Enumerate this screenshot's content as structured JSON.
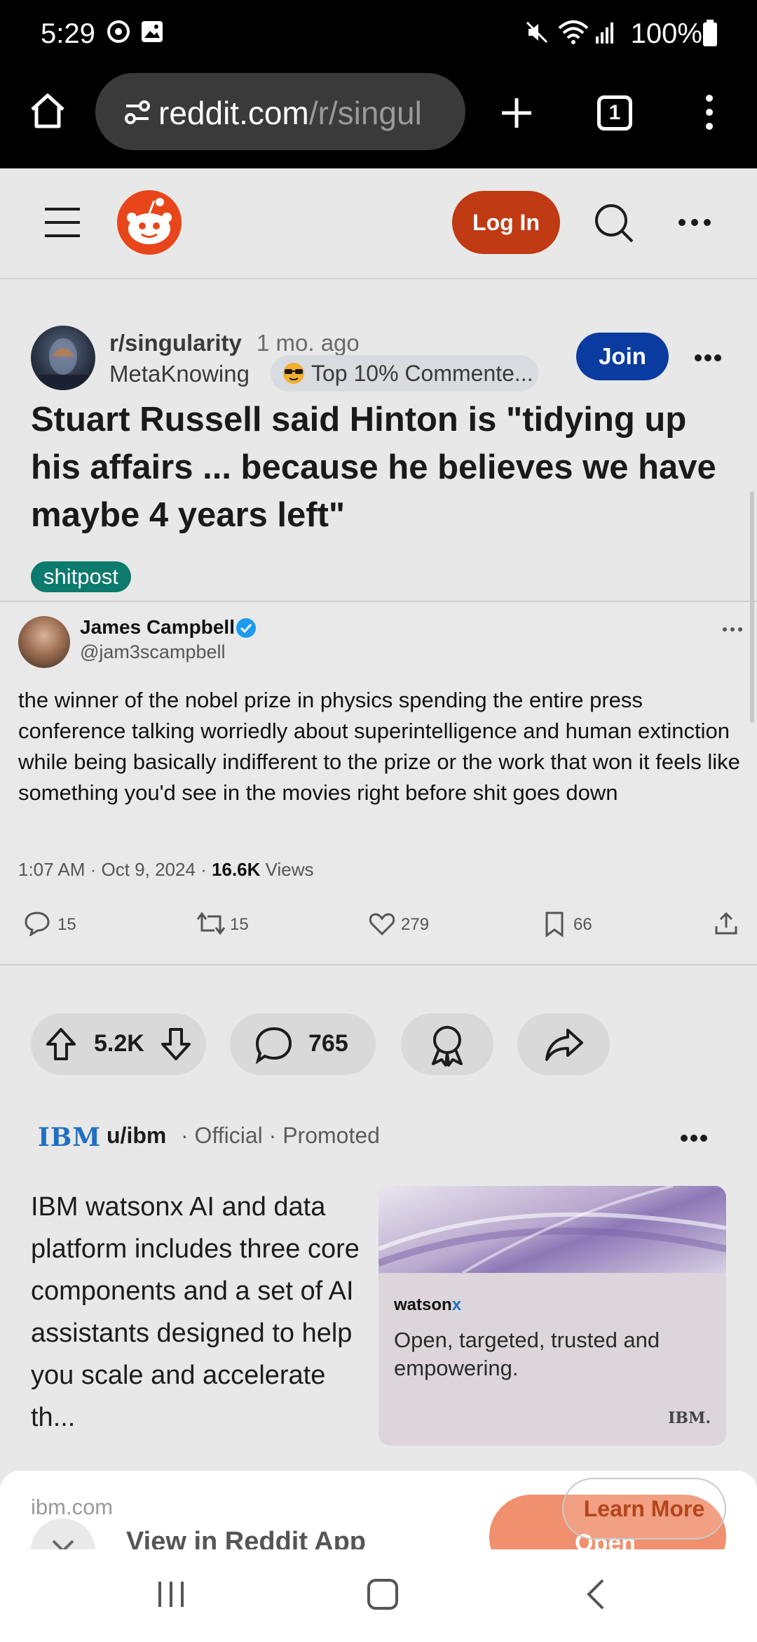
{
  "status_bar": {
    "time": "5:29",
    "battery": "100%"
  },
  "browser": {
    "url_host": "reddit.com",
    "url_path": "/r/singul",
    "tab_count": "1"
  },
  "reddit_header": {
    "login_label": "Log In"
  },
  "post": {
    "subreddit": "r/singularity",
    "age": "1 mo. ago",
    "author": "MetaKnowing",
    "user_flair": "Top 10% Commente...",
    "join_label": "Join",
    "title": "Stuart Russell said Hinton is \"tidying up his affairs ... because he believes we have maybe 4 years left\"",
    "tag": "shitpost",
    "votes": "5.2K",
    "comments": "765"
  },
  "tweet": {
    "name": "James Campbell",
    "handle": "@jam3scampbell",
    "text": "the winner of the nobel prize in physics spending the entire press conference talking worriedly about superintelligence and human extinction while being basically indifferent to the prize or the work that won it feels like something you'd see in the movies right before shit goes down",
    "date": "1:07 AM · Oct 9, 2024 · ",
    "views_count": "16.6K",
    "views_label": " Views",
    "replies": "15",
    "retweets": "15",
    "likes": "279",
    "bookmarks": "66"
  },
  "ad": {
    "logo": "IBM",
    "user": "u/ibm",
    "official": "· Official  ·  Promoted",
    "body": "IBM watsonx AI and data platform includes three core components and a set of AI assistants designed to help you scale and accelerate th...",
    "card_brand": "watson",
    "card_brand_x": "x",
    "card_tagline": "Open, targeted, trusted and empowering.",
    "card_logo": "IBM.",
    "domain": "ibm.com",
    "learn_more": "Learn More"
  },
  "app_banner": {
    "view_in_app": "View in Reddit App",
    "open_label": "Open"
  }
}
